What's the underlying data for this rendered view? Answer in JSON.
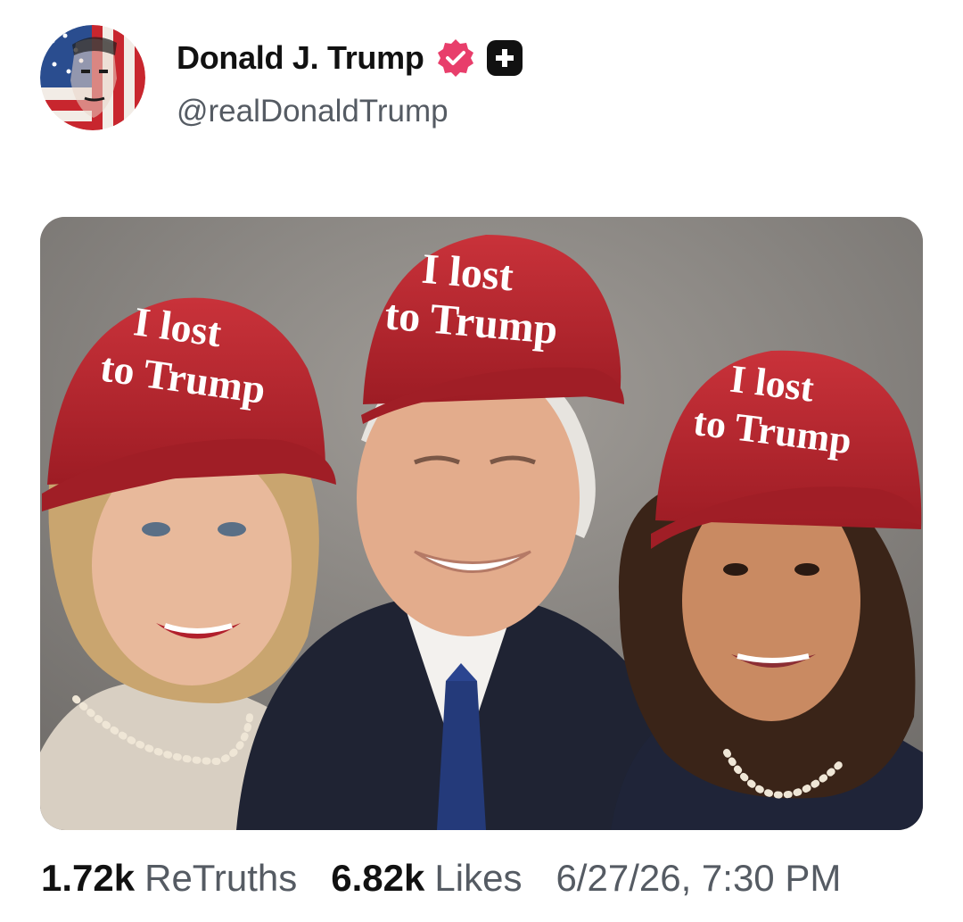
{
  "post": {
    "author": {
      "display_name": "Donald J. Trump",
      "handle": "@realDonaldTrump",
      "verified_icon": "verified-badge-icon",
      "plus_icon": "plus-badge-icon"
    },
    "image": {
      "hat_text_line1": "I lost",
      "hat_text_line2": "to Trump"
    },
    "stats": {
      "retruths_count": "1.72k",
      "retruths_label": "ReTruths",
      "likes_count": "6.82k",
      "likes_label": "Likes",
      "timestamp": "6/27/26, 7:30 PM"
    }
  },
  "colors": {
    "text_primary": "#111111",
    "text_secondary": "#555b63",
    "verified_pink": "#e83e6b",
    "cap_red": "#b3222b"
  }
}
